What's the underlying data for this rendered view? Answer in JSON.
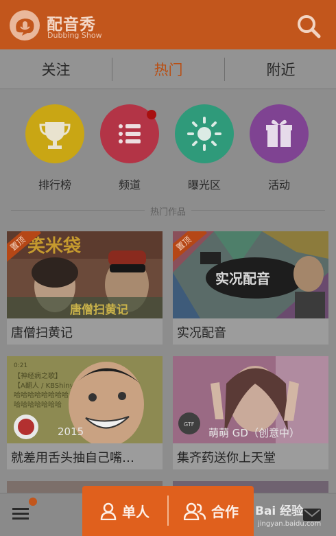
{
  "app": {
    "name": "配音秀",
    "subtitle": "Dubbing Show"
  },
  "tabs": [
    {
      "label": "关注"
    },
    {
      "label": "热门",
      "active": true
    },
    {
      "label": "附近"
    }
  ],
  "categories": [
    {
      "label": "排行榜",
      "icon": "trophy-icon",
      "color": "#c9a614"
    },
    {
      "label": "频道",
      "icon": "list-icon",
      "color": "#b33446",
      "has_notification": true
    },
    {
      "label": "曝光区",
      "icon": "sun-icon",
      "color": "#2f9a7a"
    },
    {
      "label": "活动",
      "icon": "gift-icon",
      "color": "#7f4392"
    }
  ],
  "section_title": "热门作品",
  "cards": [
    {
      "title": "唐僧扫黄记",
      "badge": "置顶",
      "thumb_caption": ""
    },
    {
      "title": "实况配音",
      "badge": "置顶",
      "thumb_caption": ""
    },
    {
      "title": "就差用舌头抽自己嘴…",
      "badge": "",
      "thumb_caption": "2015"
    },
    {
      "title": "集齐药送你上天堂",
      "badge": "",
      "thumb_caption": "萌萌 GD（创意中）"
    }
  ],
  "bottom": {
    "single_label": "单人",
    "coop_label": "合作",
    "watermark": "Bai 经验",
    "watermark_sub": "jingyan.baidu.com"
  },
  "colors": {
    "accent": "#e0601d",
    "header": "#c2561c"
  }
}
